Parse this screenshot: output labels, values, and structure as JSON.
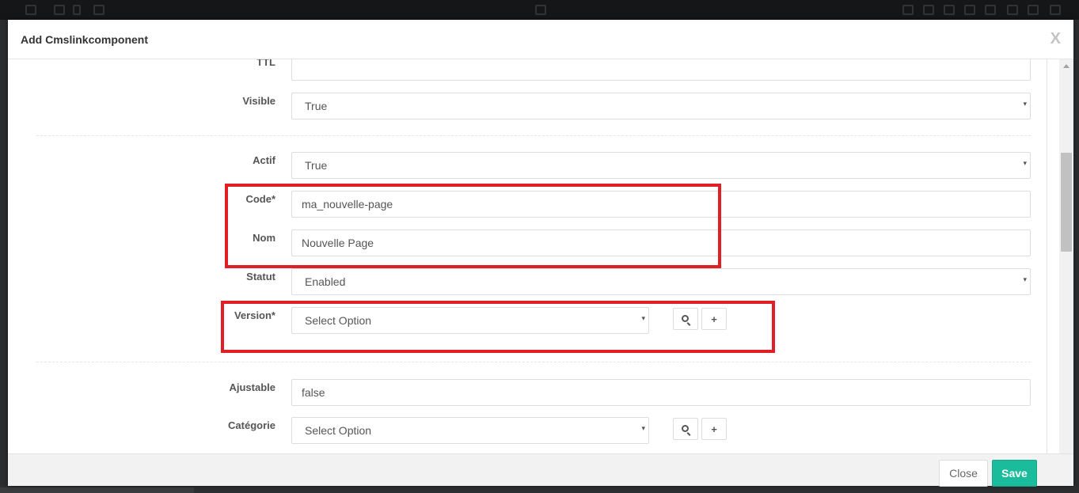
{
  "modal": {
    "title": "Add Cmslinkcomponent",
    "close_x": "X"
  },
  "fields": {
    "ttl": {
      "label": "TTL",
      "value": ""
    },
    "visible": {
      "label": "Visible",
      "value": "True"
    },
    "actif": {
      "label": "Actif",
      "value": "True"
    },
    "code": {
      "label": "Code*",
      "value": "ma_nouvelle-page"
    },
    "nom": {
      "label": "Nom",
      "value": "Nouvelle Page"
    },
    "statut": {
      "label": "Statut",
      "value": "Enabled"
    },
    "version": {
      "label": "Version*",
      "value": "Select Option"
    },
    "ajustable": {
      "label": "Ajustable",
      "value": "false"
    },
    "categorie": {
      "label": "Catégorie",
      "value": "Select Option"
    }
  },
  "icons": {
    "caret": "▾",
    "add": "+"
  },
  "footer": {
    "close_label": "Close",
    "save_label": "Save"
  },
  "colors": {
    "accent": "#1abc9c",
    "highlight": "#e01e26"
  }
}
